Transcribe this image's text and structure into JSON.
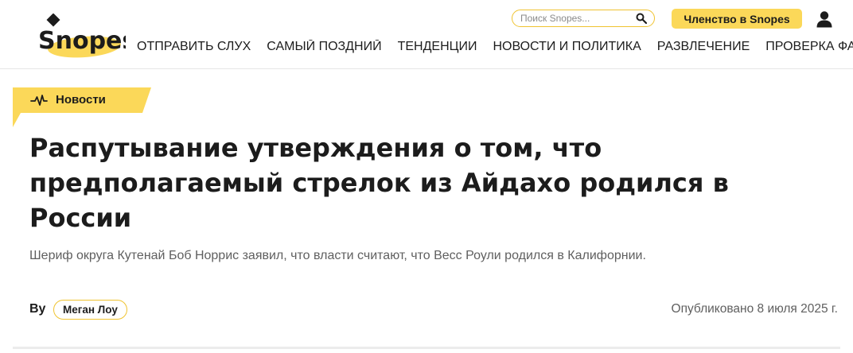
{
  "header": {
    "logo_text": "Snopes",
    "search": {
      "placeholder": "Поиск Snopes..."
    },
    "membership_label": "Членство в Snopes",
    "nav": [
      "ОТПРАВИТЬ СЛУХ",
      "САМЫЙ ПОЗДНИЙ",
      "ТЕНДЕНЦИИ",
      "НОВОСТИ И ПОЛИТИКА",
      "РАЗВЛЕЧЕНИЕ",
      "ПРОВЕРКА ФАКТОВ"
    ]
  },
  "article": {
    "category": "Новости",
    "title": "Распутывание утверждения о том, что предполагаемый стрелок из Айдахо родился в России",
    "subtitle": "Шериф округа Кутенай Боб Норрис заявил, что власти считают, что Весс Роули родился в Калифорнии.",
    "by_label": "By",
    "author": "Меган Лоу",
    "published": "Опубликовано 8 июля 2025 г."
  },
  "colors": {
    "accent": "#fbd859",
    "border_accent": "#f0c330",
    "text": "#1c1c1c",
    "muted": "#5f5f5f"
  },
  "icons": [
    "search-icon",
    "user-icon",
    "pulse-icon",
    "logo-diamond-icon"
  ]
}
